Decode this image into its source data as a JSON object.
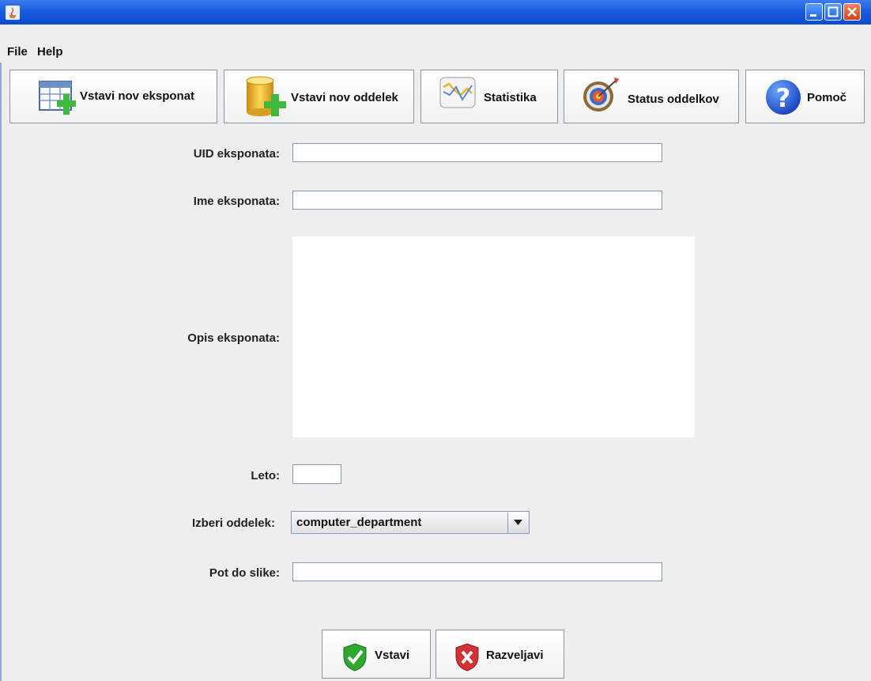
{
  "menu": {
    "file": "File",
    "help": "Help"
  },
  "toolbar": {
    "insert_exhibit": "Vstavi nov eksponat",
    "insert_department": "Vstavi nov oddelek",
    "statistics": "Statistika",
    "department_status": "Status oddelkov",
    "help": "Pomoč"
  },
  "form": {
    "uid_label": "UID eksponata:",
    "uid_value": "",
    "name_label": "Ime eksponata:",
    "name_value": "",
    "description_label": "Opis eksponata:",
    "description_value": "",
    "year_label": "Leto:",
    "year_value": "",
    "department_label": "Izberi oddelek:",
    "department_selected": "computer_department",
    "image_path_label": "Pot do slike:",
    "image_path_value": ""
  },
  "actions": {
    "insert": "Vstavi",
    "cancel": "Razveljavi"
  },
  "colors": {
    "titlebar": "#1c5fe0",
    "background": "#eeeeee",
    "field_border": "#7f9db9"
  }
}
